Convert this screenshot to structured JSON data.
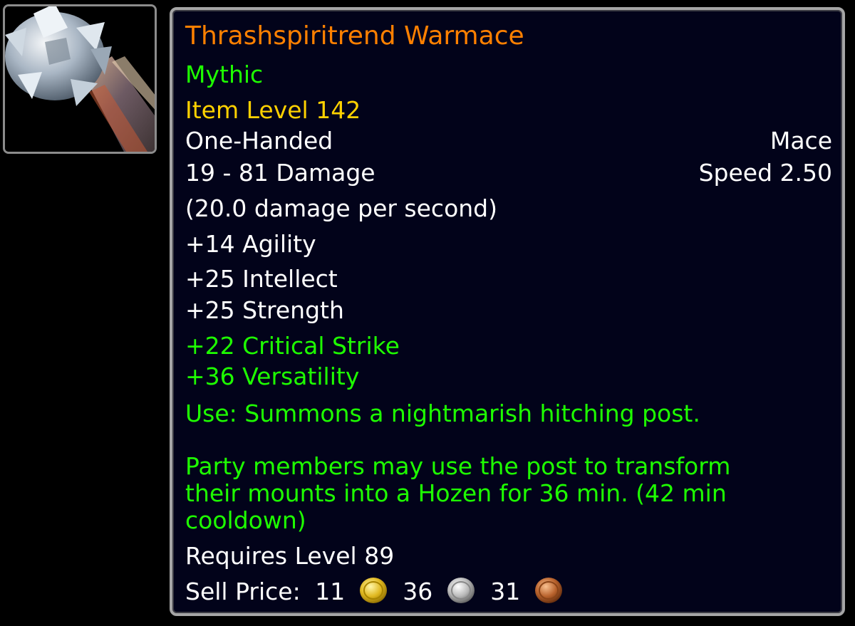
{
  "item": {
    "name": "Thrashspiritrend Warmace",
    "quality": "Mythic",
    "item_level": "Item Level 142",
    "slot": "One-Handed",
    "type": "Mace",
    "damage": "19 - 81 Damage",
    "speed": "Speed 2.50",
    "dps": "(20.0 damage per second)",
    "stats": [
      "+14 Agility",
      "+25 Intellect",
      "+25 Strength"
    ],
    "secondary_stats": [
      "+22 Critical Strike",
      "+36 Versatility"
    ],
    "use_text": "Use: Summons a nightmarish hitching post.",
    "description": "Party members may use the post to transform their mounts into a Hozen for 36 min. (42 min cooldown)",
    "requires": "Requires Level 89",
    "sell_price": {
      "label": "Sell Price:",
      "gold": "11",
      "silver": "36",
      "copper": "31"
    },
    "icon": "mace-icon"
  },
  "colors": {
    "name": "#ff8000",
    "quality": "#1eff00",
    "item_level": "#ffd100",
    "background": "#02031a",
    "border": "#a6a6a6"
  }
}
